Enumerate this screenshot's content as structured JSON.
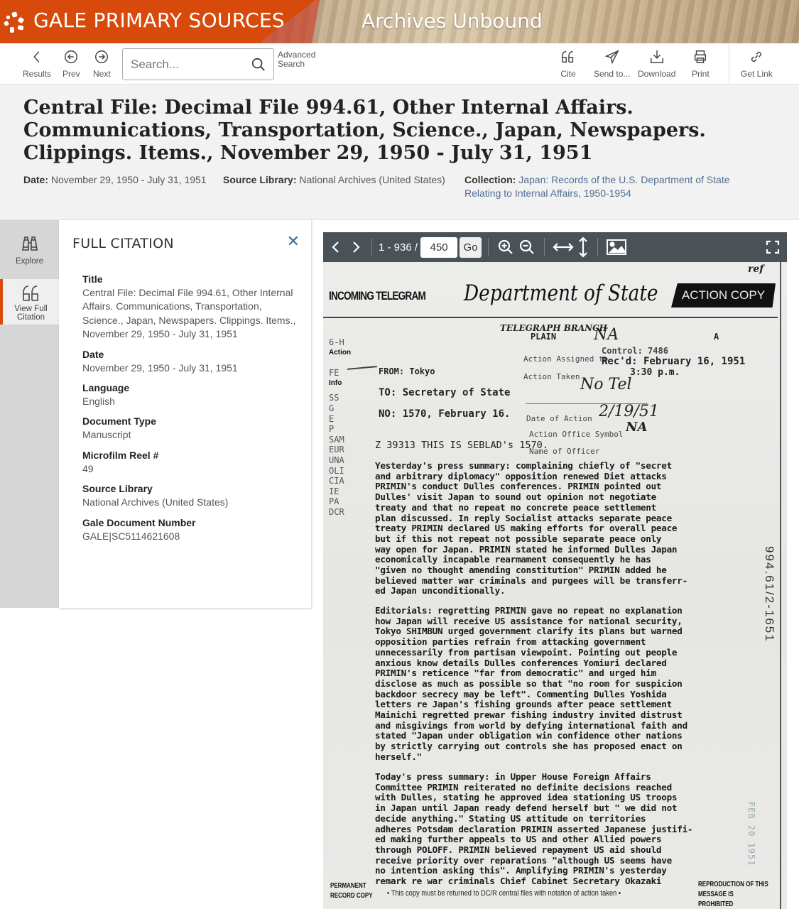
{
  "brand": {
    "name": "GALE PRIMARY SOURCES",
    "product": "Archives Unbound",
    "accent_color": "#d84a0c"
  },
  "toolbar": {
    "results_label": "Results",
    "prev_label": "Prev",
    "next_label": "Next",
    "search_placeholder": "Search...",
    "advanced_search_line1": "Advanced",
    "advanced_search_line2": "Search",
    "cite_label": "Cite",
    "send_label": "Send to...",
    "download_label": "Download",
    "print_label": "Print",
    "get_link_label": "Get Link"
  },
  "document": {
    "title": "Central File: Decimal File 994.61, Other Internal Affairs. Communications, Transportation, Science., Japan, Newspapers. Clippings. Items., November 29, 1950 - July 31, 1951",
    "date_label": "Date:",
    "date": "November 29, 1950 - July 31, 1951",
    "source_label": "Source Library:",
    "source": "National Archives (United States)",
    "collection_label": "Collection:",
    "collection_line1": "Japan: Records of the U.S. Department of State",
    "collection_line2": "Relating to Internal Affairs, 1950-1954",
    "link_color": "#4f6f92"
  },
  "rail": {
    "explore_label": "Explore",
    "citation_label_line1": "View Full",
    "citation_label_line2": "Citation"
  },
  "citation": {
    "heading": "FULL CITATION",
    "fields": [
      {
        "label": "Title",
        "value": "Central File: Decimal File 994.61, Other Internal Affairs. Communications, Transportation, Science., Japan, Newspapers. Clippings. Items., November 29, 1950 - July 31, 1951"
      },
      {
        "label": "Date",
        "value": "November 29, 1950 - July 31, 1951"
      },
      {
        "label": "Language",
        "value": "English"
      },
      {
        "label": "Document Type",
        "value": "Manuscript"
      },
      {
        "label": "Microfilm Reel #",
        "value": "49"
      },
      {
        "label": "Source Library",
        "value": "National Archives (United States)"
      },
      {
        "label": "Gale Document Number",
        "value": "GALE|SC5114621608"
      }
    ]
  },
  "viewer": {
    "page_range": "1 - 936 /",
    "current_page": "450",
    "go_label": "Go"
  },
  "scan": {
    "incoming": "INCOMING TELEGRAM",
    "department": "Department of State",
    "action_copy": "ACTION COPY",
    "telegraph_branch": "TELEGRAPH BRANCH",
    "plain": "PLAIN",
    "hand_na": "NA",
    "letter_a": "A",
    "control": "Control: 7486",
    "recd": "Rec'd: February 16, 1951",
    "time": "3:30 p.m.",
    "action_assigned": "Action Assigned to",
    "action_taken": "Action Taken",
    "hand_notel": "No Tel",
    "date_of_action": "Date of Action",
    "hand_date": "2/19/51",
    "action_office": "Action Office Symbol",
    "hand_na2": "NA",
    "name_officer": "Name of Officer",
    "codes_top": [
      "6-H",
      "Action"
    ],
    "codes_fe": [
      "FE",
      "Info"
    ],
    "codes": [
      "SS",
      "G",
      "E",
      "P",
      "SAM",
      "EUR",
      "UNA",
      "OLI",
      "CIA",
      "IE",
      "PA",
      "DCR"
    ],
    "from": "FROM: Tokyo",
    "to": "TO:  Secretary of State",
    "no": "NO:  1570, February 16.",
    "ref": "Z 39313 THIS IS SEBLAD's 1570.",
    "para1": "Yesterday's press summary: complaining chiefly of \"secret\nand arbitrary diplomacy\" opposition renewed Diet attacks\nPRIMIN's conduct Dulles conferences.  PRIMIN pointed out\nDulles' visit Japan to sound out opinion not negotiate\ntreaty and that no repeat no concrete peace settlement\nplan discussed.  In reply Socialist attacks separate peace\ntreaty PRIMIN declared US making efforts for overall peace\nbut if this not repeat not possible separate peace only\nway open for Japan.  PRIMIN stated he informed Dulles Japan\neconomically incapable rearmament consequently he has\n\"given no thought amending constitution\" PRIMIN added he\nbelieved matter war criminals and purgees will be transferr-\ned Japan unconditionally.",
    "para2": "Editorials: regretting PRIMIN gave no repeat no explanation\nhow Japan will receive US assistance for national security,\nTokyo SHIMBUN urged government clarify its plans but warned\nopposition parties refrain from attacking government\nunnecessarily from partisan viewpoint.  Pointing out people\nanxious know details Dulles conferences Yomiuri declared\nPRIMIN's reticence \"far from democratic\" and urged him\ndisclose as much as possible so that \"no room for suspicion\nbackdoor secrecy may be left\".  Commenting Dulles Yoshida\nletters re Japan's fishing grounds after peace settlement\nMainichi regretted prewar fishing industry invited distrust\nand misgivings from world by defying international faith and\nstated \"Japan under obligation win confidence other nations\nby strictly carrying out controls she has proposed enact on\nherself.\"",
    "para3": "Today's press summary: in Upper House Foreign Affairs\nCommittee PRIMIN reiterated no definite decisions reached\nwith Dulles, stating he approved idea stationing US troops\nin Japan until Japan ready defend herself but \" we did not\ndecide anything.\"  Stating US attitude on territories\nadheres Potsdam declaration PRIMIN asserted Japanese justifi-\ned making further appeals to US and other Allied powers\nthrough POLOFF.  PRIMIN believed repayment US aid should\nreceive priority over reparations \"although US seems have\nno intention asking this\".  Amplifying PRIMIN's yesterday\nremark re war criminals Chief Cabinet Secretary Okazaki",
    "file_stamp": "994.61/2-1651",
    "feb_stamp": "FEB 20 1951",
    "permanent_1": "PERMANENT",
    "permanent_2": "RECORD COPY",
    "footer_note": "• This copy must be returned to DC/R central files with notation of action taken •",
    "repro_1": "REPRODUCTION OF THIS",
    "repro_2": "MESSAGE IS PROHIBITED"
  }
}
